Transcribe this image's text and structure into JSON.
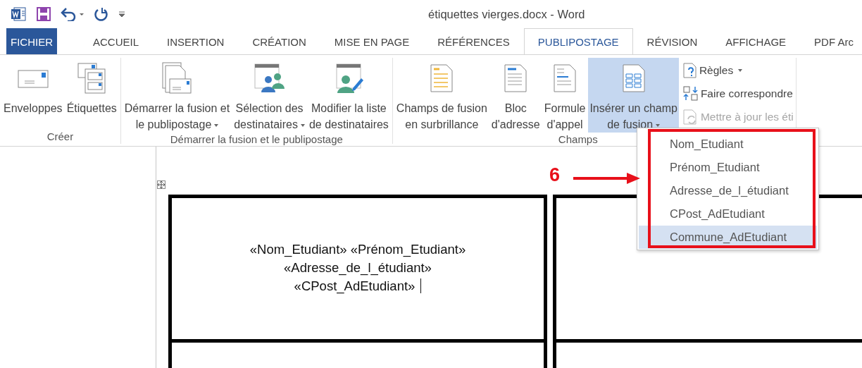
{
  "window": {
    "title": "étiquettes vierges.docx - Word"
  },
  "quick_access": [
    {
      "kind": "word"
    },
    {
      "kind": "save"
    },
    {
      "kind": "undo"
    },
    {
      "kind": "redo"
    },
    {
      "kind": "customize"
    }
  ],
  "tabs": [
    {
      "label": "FICHIER",
      "kind": "file",
      "selected": false
    },
    {
      "label": "ACCUEIL",
      "kind": "tab",
      "selected": false
    },
    {
      "label": "INSERTION",
      "kind": "tab",
      "selected": false
    },
    {
      "label": "CRÉATION",
      "kind": "tab",
      "selected": false
    },
    {
      "label": "MISE EN PAGE",
      "kind": "tab",
      "selected": false
    },
    {
      "label": "RÉFÉRENCES",
      "kind": "tab",
      "selected": false
    },
    {
      "label": "PUBLIPOSTAGE",
      "kind": "tab",
      "selected": true
    },
    {
      "label": "RÉVISION",
      "kind": "tab",
      "selected": false
    },
    {
      "label": "AFFICHAGE",
      "kind": "tab",
      "selected": false
    },
    {
      "label": "PDF Arc",
      "kind": "tab",
      "selected": false
    }
  ],
  "ribbon": {
    "groups": [
      {
        "label": "Créer",
        "buttons": [
          {
            "kind": "large",
            "lines": [
              "Enveloppes"
            ],
            "dropdown": false,
            "pressed": false
          },
          {
            "kind": "large",
            "lines": [
              "Étiquettes"
            ],
            "dropdown": false,
            "pressed": false
          }
        ]
      },
      {
        "label": "Démarrer la fusion et le publipostage",
        "buttons": [
          {
            "kind": "large",
            "lines": [
              "Démarrer la fusion et",
              "le publipostage"
            ],
            "dropdown": true,
            "pressed": false
          },
          {
            "kind": "large",
            "lines": [
              "Sélection des",
              "destinataires"
            ],
            "dropdown": true,
            "pressed": false
          },
          {
            "kind": "large",
            "lines": [
              "Modifier la liste",
              "de destinataires"
            ],
            "dropdown": false,
            "pressed": false
          }
        ]
      },
      {
        "label": "Champs",
        "buttons": [
          {
            "kind": "large",
            "lines": [
              "Champs de fusion",
              "en surbrillance"
            ],
            "dropdown": false,
            "pressed": false
          },
          {
            "kind": "large",
            "lines": [
              "Bloc",
              "d'adresse"
            ],
            "dropdown": false,
            "pressed": false
          },
          {
            "kind": "large",
            "lines": [
              "Formule",
              "d'appel"
            ],
            "dropdown": false,
            "pressed": false
          },
          {
            "kind": "large",
            "lines": [
              "Insérer un champ",
              "de fusion"
            ],
            "dropdown": true,
            "pressed": true
          },
          {
            "kind": "small",
            "label": "Règles",
            "dropdown": true,
            "disabled": false
          },
          {
            "kind": "small",
            "label": "Faire correspondre",
            "dropdown": false,
            "disabled": false
          },
          {
            "kind": "small",
            "label": "Mettre à jour les éti",
            "dropdown": false,
            "disabled": true
          }
        ]
      }
    ]
  },
  "merge_field_menu": {
    "items": [
      {
        "label": "Nom_Etudiant",
        "selected": false
      },
      {
        "label": "Prénom_Etudiant",
        "selected": false
      },
      {
        "label": "Adresse_de_l_étudiant",
        "selected": false
      },
      {
        "label": "CPost_AdEtudiant",
        "selected": false
      },
      {
        "label": "Commune_AdEtudiant",
        "selected": true
      }
    ]
  },
  "annotation": {
    "label": "6"
  },
  "document": {
    "label_lines": [
      "«Nom_Etudiant» «Prénom_Etudiant»",
      "«Adresse_de_l_étudiant»",
      "«CPost_AdEtudiant»"
    ],
    "cursor": true
  }
}
